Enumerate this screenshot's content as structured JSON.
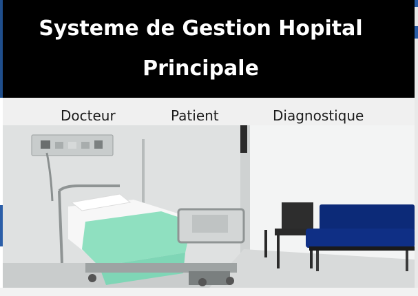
{
  "window": {
    "title_line1": "Systeme de Gestion Hopital",
    "title_line2": "Principale"
  },
  "menu": {
    "items": [
      {
        "label": "Docteur"
      },
      {
        "label": "Patient"
      },
      {
        "label": "Diagnostique"
      }
    ]
  },
  "image": {
    "subject": "hospital-room-photo"
  },
  "colors": {
    "banner_bg": "#000000",
    "banner_text": "#ffffff",
    "menubar_bg": "#f0f0f0",
    "sheet": "#8fe0c0",
    "bench": "#0c2a78"
  }
}
